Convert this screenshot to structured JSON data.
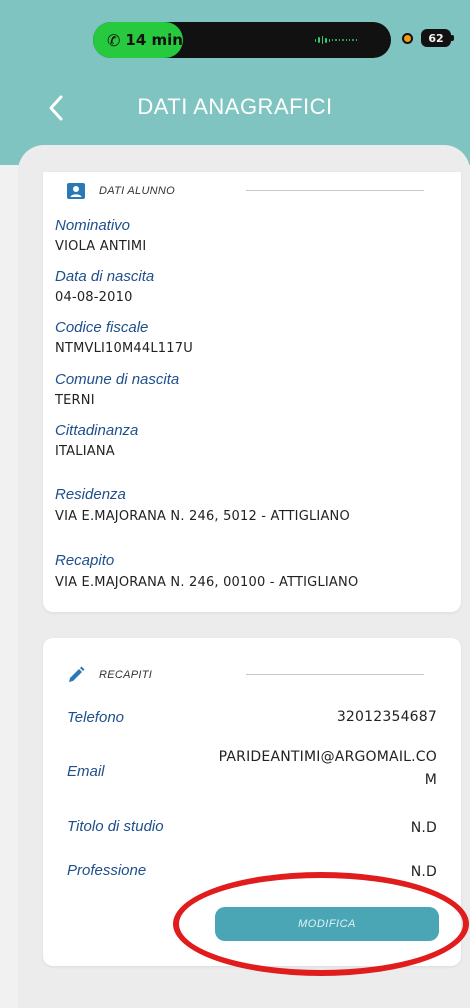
{
  "status_bar": {
    "call_duration": "14 min",
    "battery_level": "62"
  },
  "header": {
    "title": "DATI ANAGRAFICI"
  },
  "student_section": {
    "heading": "DATI ALUNNO",
    "fields": [
      {
        "label": "Nominativo",
        "value": "VIOLA ANTIMI"
      },
      {
        "label": "Data di nascita",
        "value": "04-08-2010"
      },
      {
        "label": "Codice fiscale",
        "value": "NTMVLI10M44L117U"
      },
      {
        "label": "Comune di nascita",
        "value": "TERNI"
      },
      {
        "label": "Cittadinanza",
        "value": "ITALIANA"
      },
      {
        "label": "Residenza",
        "value": "VIA E.MAJORANA N. 246, 5012 - ATTIGLIANO"
      },
      {
        "label": "Recapito",
        "value": "VIA E.MAJORANA N. 246, 00100 - ATTIGLIANO"
      }
    ]
  },
  "contacts_section": {
    "heading": "RECAPITI",
    "rows": [
      {
        "label": "Telefono",
        "value": "32012354687"
      },
      {
        "label": "Email",
        "value": "PARIDEANTIMI@ARGOMAIL.CO M"
      },
      {
        "label": "Titolo di studio",
        "value": "N.D"
      },
      {
        "label": "Professione",
        "value": "N.D"
      }
    ],
    "modify_label": "MODIFICA"
  },
  "colors": {
    "header_bg": "#7fc4c0",
    "label_blue": "#1e4f8c",
    "button_teal": "#4aa5b5",
    "annotation_red": "#e01c1c"
  },
  "icons": {
    "back": "chevron-left-icon",
    "student": "person-card-icon",
    "contacts": "pencil-icon",
    "call": "phone-icon"
  }
}
